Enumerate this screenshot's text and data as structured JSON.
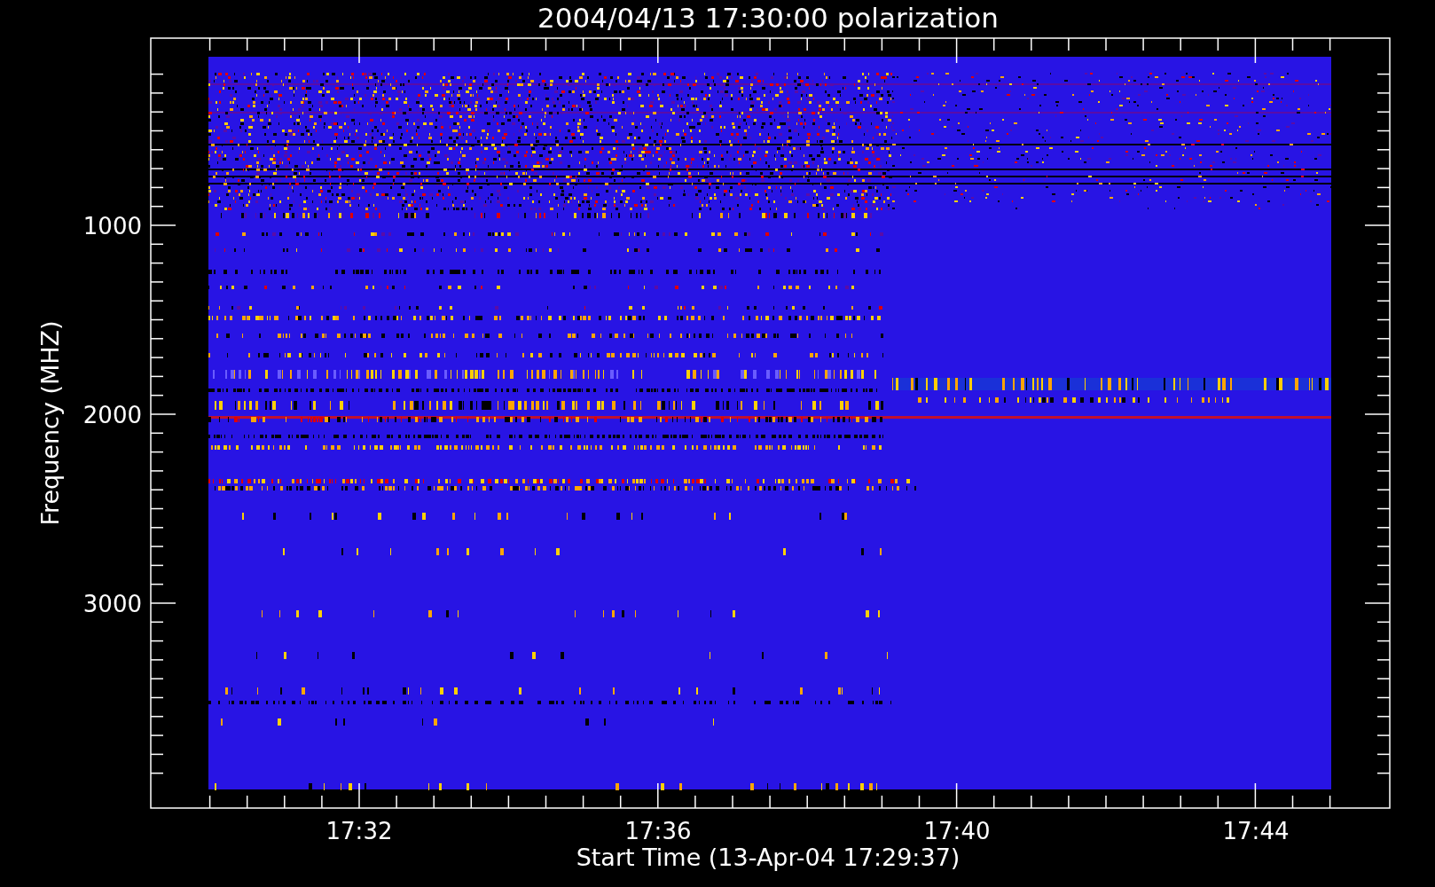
{
  "plot": {
    "title": "2004/04/13 17:30:00 polarization",
    "xlabel": "Start Time (13-Apr-04 17:29:37)",
    "ylabel": "Frequency (MHZ)",
    "xticks": [
      "17:32",
      "17:36",
      "17:40",
      "17:44"
    ],
    "yticks": [
      "1000",
      "2000",
      "3000"
    ]
  }
}
